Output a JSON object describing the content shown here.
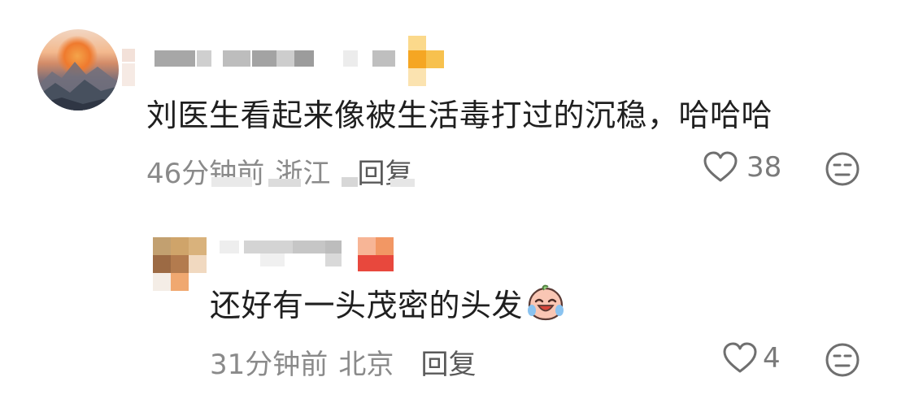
{
  "comments": [
    {
      "content": "刘医生看起来像被生活毒打过的沉稳，哈哈哈",
      "time": "46分钟前",
      "location": "浙江",
      "reply_label": "回复",
      "likes": "38"
    },
    {
      "content": "还好有一头茂密的头发",
      "content_emoji": "crying-laughing-peach-emoji",
      "time": "31分钟前",
      "location": "北京",
      "reply_label": "回复",
      "likes": "4"
    }
  ],
  "icons": {
    "like": "heart-outline-icon",
    "react": "neutral-face-icon"
  },
  "colors": {
    "text": "#1f1f1f",
    "meta": "#8a8a8a",
    "badge_orange": "#f5a623",
    "badge_red": "#e8483d"
  }
}
